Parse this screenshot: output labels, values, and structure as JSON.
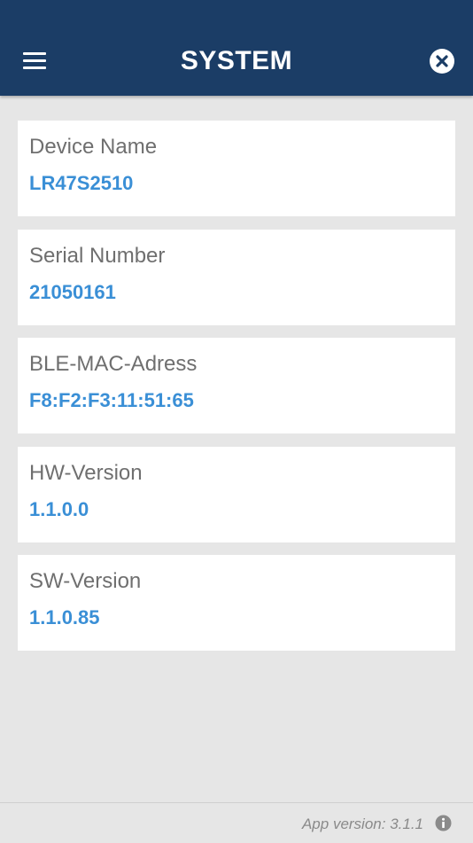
{
  "header": {
    "title": "SYSTEM",
    "menu_icon": "hamburger-menu-icon",
    "close_icon": "close-circle-icon",
    "background_color": "#1b3d66"
  },
  "cards": [
    {
      "label": "Device Name",
      "value": "LR47S2510"
    },
    {
      "label": "Serial Number",
      "value": "21050161"
    },
    {
      "label": "BLE-MAC-Adress",
      "value": "F8:F2:F3:11:51:65"
    },
    {
      "label": "HW-Version",
      "value": "1.1.0.0"
    },
    {
      "label": "SW-Version",
      "value": "1.1.0.85"
    }
  ],
  "footer": {
    "app_version": "App version: 3.1.1",
    "info_icon": "info-icon"
  },
  "colors": {
    "accent_value": "#3a8fd6",
    "label_text": "#6f6f6f",
    "page_background": "#e6e6e6"
  }
}
